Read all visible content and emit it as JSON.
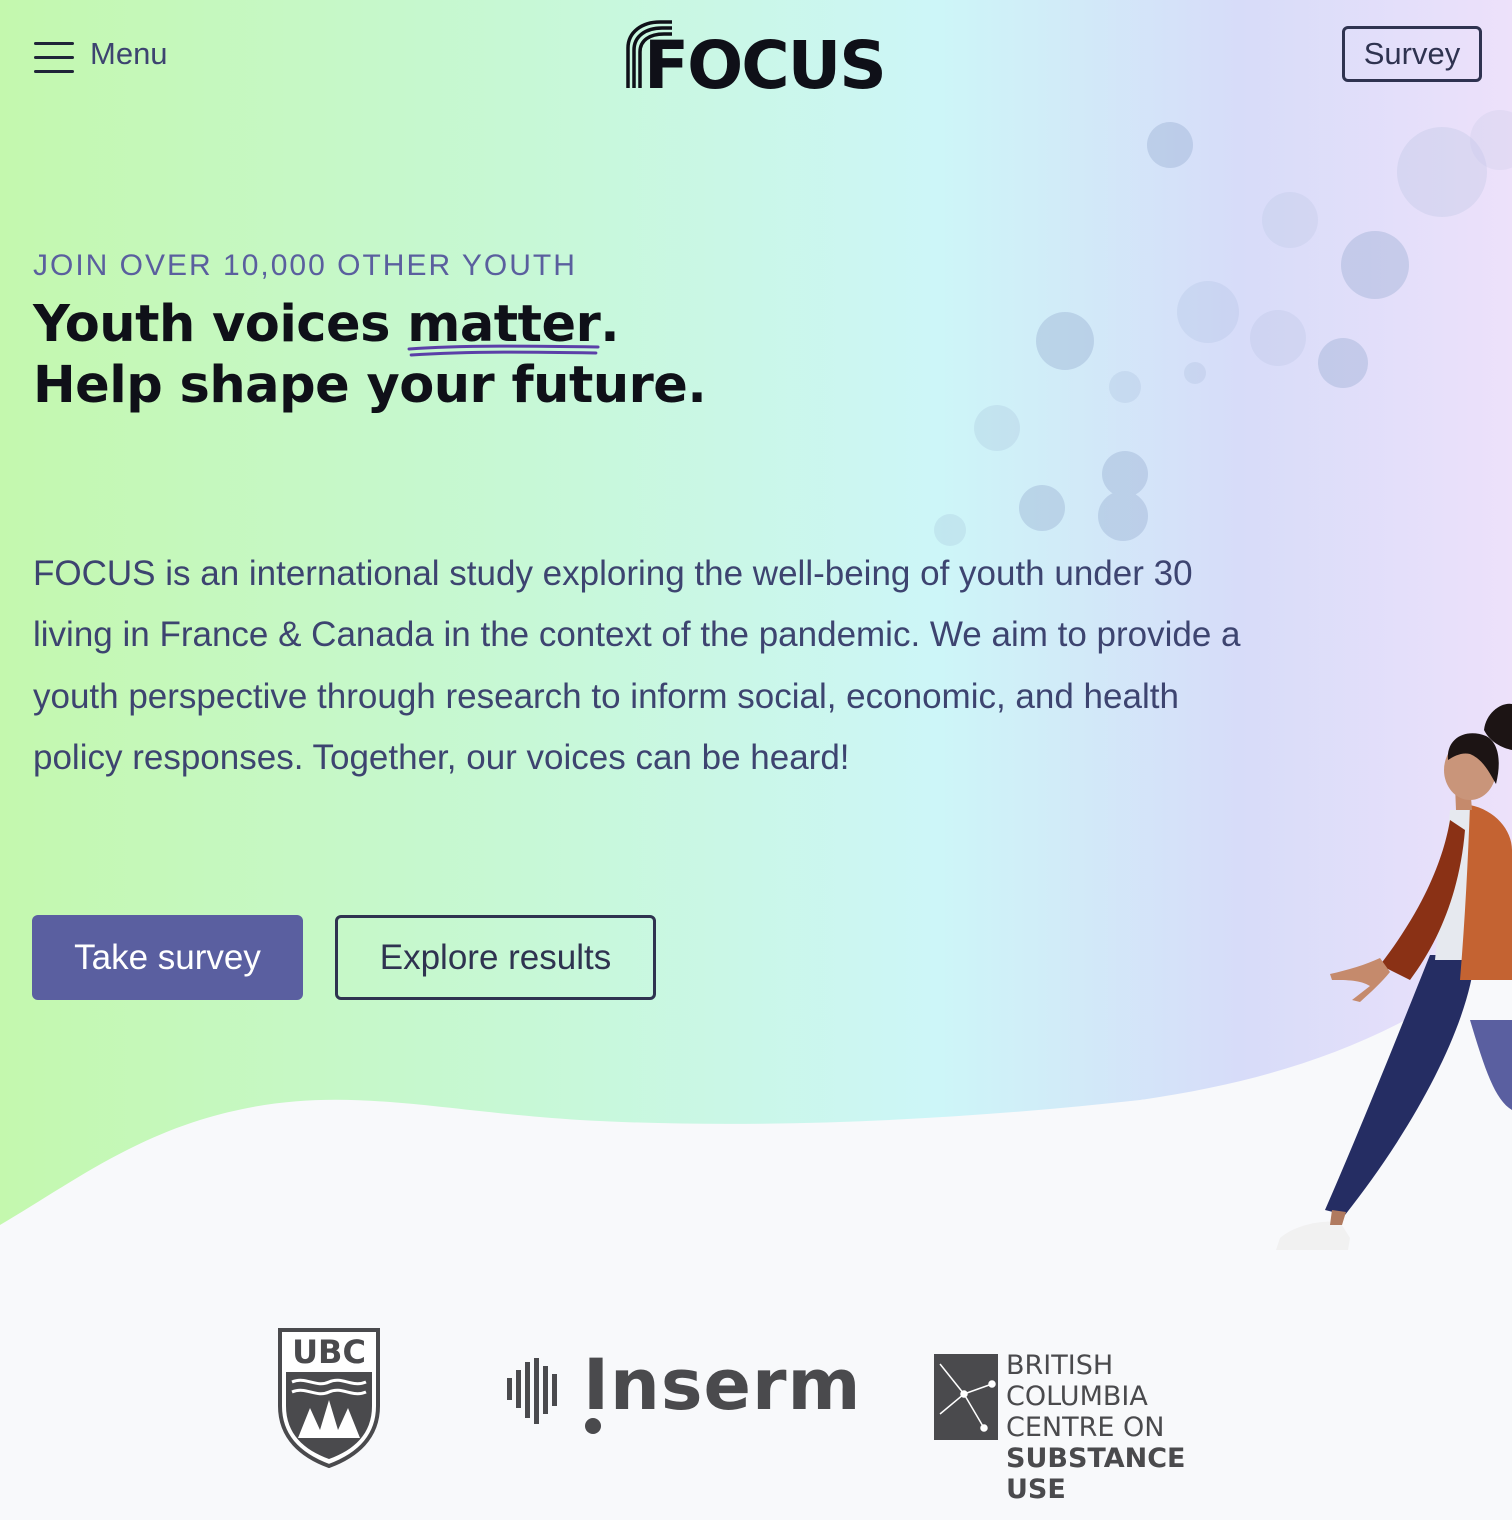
{
  "header": {
    "menu_label": "Menu",
    "logo_text": "FOCUS",
    "survey_label": "Survey"
  },
  "hero": {
    "eyebrow": "JOIN OVER 10,000 OTHER YOUTH",
    "headline_part1": "Youth voices ",
    "headline_highlight": "matter",
    "headline_period": ".",
    "headline_line2": "Help shape your future.",
    "description": "FOCUS is an international study exploring the well-being of youth under 30 living in France & Canada in the context of the pandemic. We aim to provide a youth perspective through research to inform social, economic, and health policy responses. Together, our voices can be heard!",
    "primary_cta": "Take survey",
    "secondary_cta": "Explore results"
  },
  "partners": {
    "ubc": "UBC",
    "inserm": "Inserm",
    "bccsu_line1": "BRITISH COLUMBIA",
    "bccsu_line2": "CENTRE ON",
    "bccsu_line3": "SUBSTANCE USE"
  },
  "colors": {
    "gradient_left": "#c6f9b0",
    "gradient_mid": "#cdf5f8",
    "gradient_right": "#ece0fb",
    "primary": "#5a5fa0",
    "accent_underline": "#5b3fa8",
    "text_body": "#3d4470"
  },
  "icons": {
    "menu": "hamburger-icon",
    "figure": "walking-person-illustration"
  }
}
